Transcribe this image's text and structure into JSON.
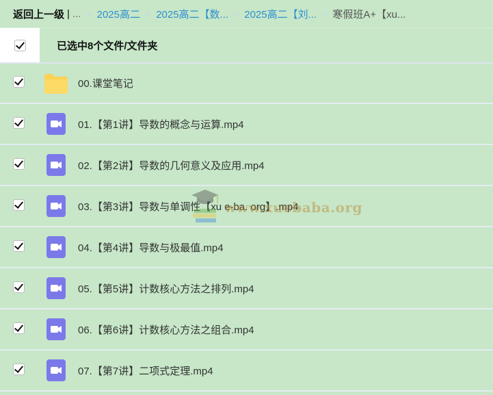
{
  "breadcrumb": {
    "back_label": "返回上一级",
    "pipe": "|",
    "ellipsis": "...",
    "arrow": ">",
    "links": [
      "2025高二",
      "2025高二【数...",
      "2025高二【刘..."
    ],
    "current": "寒假班A+【xu..."
  },
  "header": {
    "selected_label": "已选中8个文件/文件夹"
  },
  "files": [
    {
      "name": "00.课堂笔记",
      "type": "folder",
      "checked": true
    },
    {
      "name": "01.【第1讲】导数的概念与运算.mp4",
      "type": "video",
      "checked": true
    },
    {
      "name": "02.【第2讲】导数的几何意义及应用.mp4",
      "type": "video",
      "checked": true
    },
    {
      "name": "03.【第3讲】导数与单调性【xu e-ba. org】.mp4",
      "type": "video",
      "checked": true
    },
    {
      "name": "04.【第4讲】导数与极最值.mp4",
      "type": "video",
      "checked": true
    },
    {
      "name": "05.【第5讲】计数核心方法之排列.mp4",
      "type": "video",
      "checked": true
    },
    {
      "name": "06.【第6讲】计数核心方法之组合.mp4",
      "type": "video",
      "checked": true
    },
    {
      "name": "07.【第7讲】二项式定理.mp4",
      "type": "video",
      "checked": true
    }
  ],
  "watermark": {
    "text": "www.xuebaba.org"
  },
  "colors": {
    "background": "#c7e7c8",
    "link": "#2f8fd0",
    "video_icon": "#7b79ea",
    "folder_icon": "#fbd253"
  },
  "icons": {
    "folder": "folder-icon",
    "video": "video-file-icon",
    "checkbox": "checkbox-checked"
  }
}
